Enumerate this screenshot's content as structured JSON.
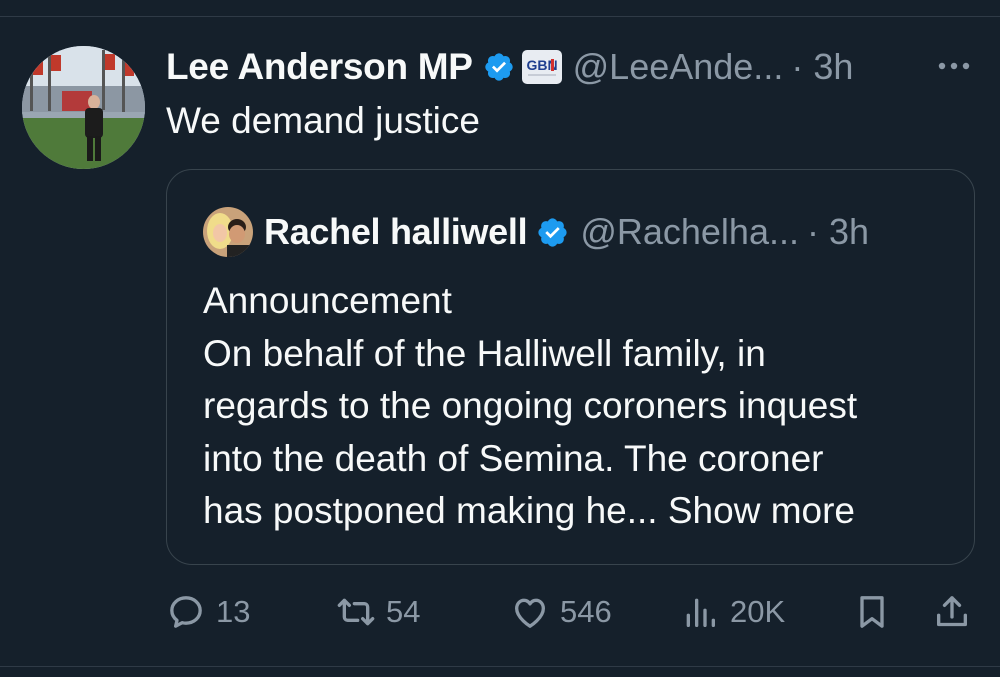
{
  "tweet": {
    "author_name": "Lee Anderson MP",
    "handle": "@LeeAnde...",
    "time": "· 3h",
    "text": "We demand justice",
    "affiliate_badge": "GBN"
  },
  "quoted_tweet": {
    "author_name": "Rachel halliwell",
    "handle": "@Rachelha...",
    "time": "· 3h",
    "lines": [
      "Announcement",
      "On behalf of the Halliwell family, in",
      "regards to the ongoing coroners inquest",
      "into the death of Semina.  The coroner",
      "has postponed making he..."
    ],
    "show_more": "Show more"
  },
  "actions": {
    "replies": "13",
    "reposts": "54",
    "likes": "546",
    "views": "20K"
  },
  "colors": {
    "background": "#15202b",
    "text": "#f7f9f9",
    "secondary": "#8b98a5",
    "verified_blue": "#1d9bf0",
    "border": "#38444d"
  },
  "icons": [
    "verified-badge-icon",
    "more-options-icon",
    "reply-icon",
    "repost-icon",
    "like-icon",
    "views-icon",
    "bookmark-icon",
    "share-icon"
  ]
}
